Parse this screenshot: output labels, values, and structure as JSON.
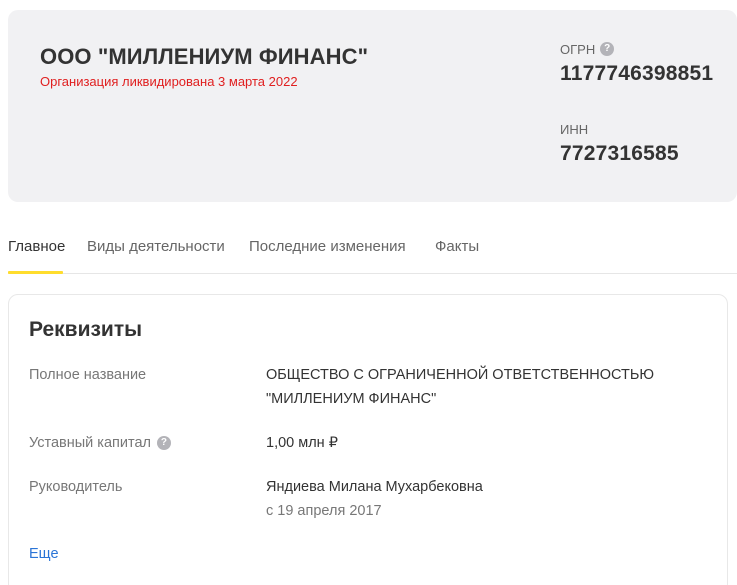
{
  "company": {
    "name": "ООО \"МИЛЛЕНИУМ ФИНАНС\"",
    "status": "Организация ликвидирована 3 марта 2022",
    "ogrn_label": "ОГРН",
    "ogrn_value": "1177746398851",
    "inn_label": "ИНН",
    "inn_value": "7727316585"
  },
  "tabs": [
    {
      "label": "Главное",
      "active": true
    },
    {
      "label": "Виды деятельности",
      "active": false
    },
    {
      "label": "Последние изменения",
      "active": false
    },
    {
      "label": "Факты",
      "active": false
    }
  ],
  "details": {
    "title": "Реквизиты",
    "full_name_label": "Полное название",
    "full_name_line1": "ОБЩЕСТВО С ОГРАНИЧЕННОЙ ОТВЕТСТВЕННОСТЬЮ",
    "full_name_line2": "\"МИЛЛЕНИУМ ФИНАНС\"",
    "capital_label": "Уставный капитал",
    "capital_value": "1,00 млн ₽",
    "director_label": "Руководитель",
    "director_value": "Яндиева Милана Мухарбековна",
    "director_since": "с 19 апреля 2017",
    "more_link": "Еще"
  },
  "colors": {
    "status_red": "#e02020",
    "tab_accent": "#ffdd2d",
    "link_blue": "#2a74d6",
    "header_bg": "#f1f1f3"
  },
  "icons": {
    "help": "question-circle-icon"
  }
}
